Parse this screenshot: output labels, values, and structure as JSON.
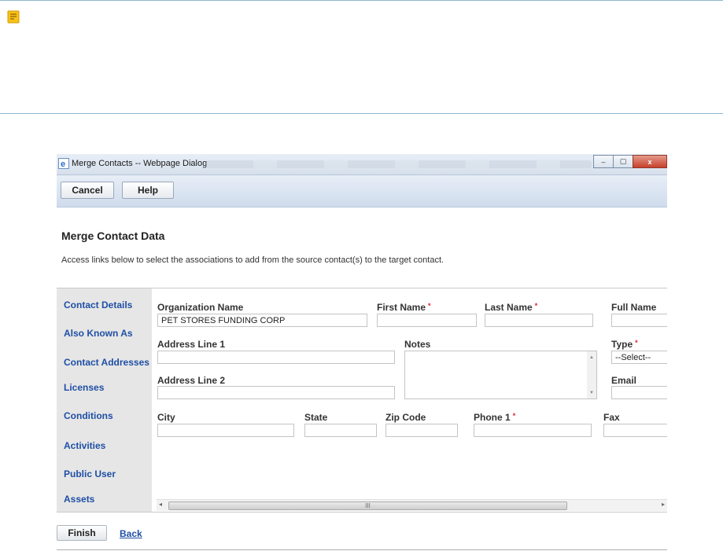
{
  "window": {
    "title": "Merge Contacts -- Webpage Dialog",
    "controls": {
      "minimize": "–",
      "maximize": "▢",
      "close": "x"
    }
  },
  "toolbar": {
    "cancel_label": "Cancel",
    "help_label": "Help"
  },
  "page": {
    "heading": "Merge Contact Data",
    "description": "Access links below to select the associations to add from the source contact(s) to the target contact."
  },
  "nav": {
    "items": [
      {
        "label": "Contact Details"
      },
      {
        "label": "Also Known As"
      },
      {
        "label": "Contact Addresses"
      },
      {
        "label": "Licenses"
      },
      {
        "label": "Conditions"
      },
      {
        "label": "Activities"
      },
      {
        "label": "Public User"
      },
      {
        "label": "Assets"
      }
    ]
  },
  "form": {
    "organization_name": {
      "label": "Organization Name",
      "value": "PET STORES FUNDING CORP"
    },
    "first_name": {
      "label": "First Name",
      "value": ""
    },
    "last_name": {
      "label": "Last Name",
      "value": ""
    },
    "full_name": {
      "label": "Full Name",
      "value": ""
    },
    "address_line_1": {
      "label": "Address Line 1",
      "value": ""
    },
    "notes": {
      "label": "Notes",
      "value": ""
    },
    "type": {
      "label": "Type",
      "value": "--Select--"
    },
    "address_line_2": {
      "label": "Address Line 2",
      "value": ""
    },
    "email": {
      "label": "Email",
      "value": ""
    },
    "city": {
      "label": "City",
      "value": ""
    },
    "state": {
      "label": "State",
      "value": ""
    },
    "zip_code": {
      "label": "Zip Code",
      "value": ""
    },
    "phone_1": {
      "label": "Phone 1",
      "value": ""
    },
    "fax": {
      "label": "Fax",
      "value": ""
    },
    "required_marker": "*"
  },
  "scrollbar": {
    "thumb_grip": "III",
    "left_arrow": "◂",
    "right_arrow": "▸"
  },
  "footer": {
    "finish_label": "Finish",
    "back_label": "Back"
  },
  "colors": {
    "link": "#1f4fa5",
    "required": "#dd2233",
    "nav_background": "#e6e6e6",
    "toolbar_background": "#d6e2f0"
  }
}
